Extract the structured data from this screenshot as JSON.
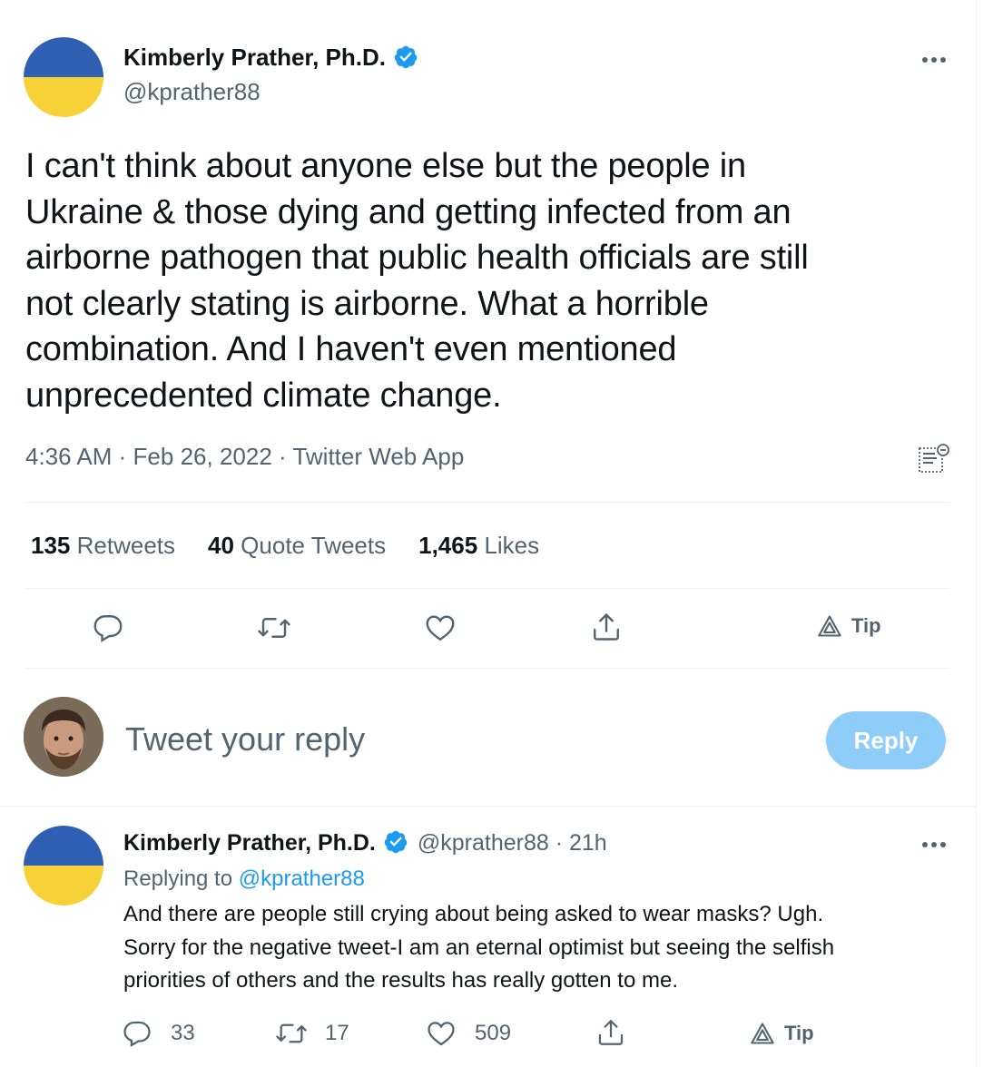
{
  "main_tweet": {
    "author_name": "Kimberly Prather, Ph.D.",
    "handle": "@kprather88",
    "text": "I can't think about anyone else but the people in\nUkraine & those dying and getting infected from an\nairborne pathogen that public health officials are still\nnot clearly stating is airborne.  What a horrible\ncombination.  And I haven't even mentioned\nunprecedented climate change.",
    "time": "4:36 AM",
    "date": "Feb 26, 2022",
    "source": "Twitter Web App",
    "separator": "·",
    "stats": {
      "retweets_count": "135",
      "retweets_label": "Retweets",
      "quotes_count": "40",
      "quotes_label": "Quote Tweets",
      "likes_count": "1,465",
      "likes_label": "Likes"
    },
    "tip_label": "Tip"
  },
  "composer": {
    "placeholder": "Tweet your reply",
    "button_label": "Reply"
  },
  "reply_tweet": {
    "author_name": "Kimberly Prather, Ph.D.",
    "handle": "@kprather88",
    "time_ago": "21h",
    "replying_prefix": "Replying to",
    "replying_handle": "@kprather88",
    "text": "And there are people still crying about being asked to wear masks?  Ugh.\nSorry for the negative tweet-I am an eternal optimist but seeing the selfish\npriorities of others and the results has really gotten to me.",
    "reply_count": "33",
    "retweet_count": "17",
    "like_count": "509",
    "tip_label": "Tip"
  },
  "colors": {
    "flag_blue": "#2f5fb3",
    "flag_yellow": "#f7d138",
    "verified_blue": "#1d9bf0",
    "secondary_text": "#536471",
    "reply_button_disabled": "#8ecdf8"
  },
  "icons": [
    "verified-badge-icon",
    "more-icon",
    "newsletter-icon",
    "reply-icon",
    "retweet-icon",
    "like-icon",
    "share-icon",
    "tip-icon"
  ]
}
